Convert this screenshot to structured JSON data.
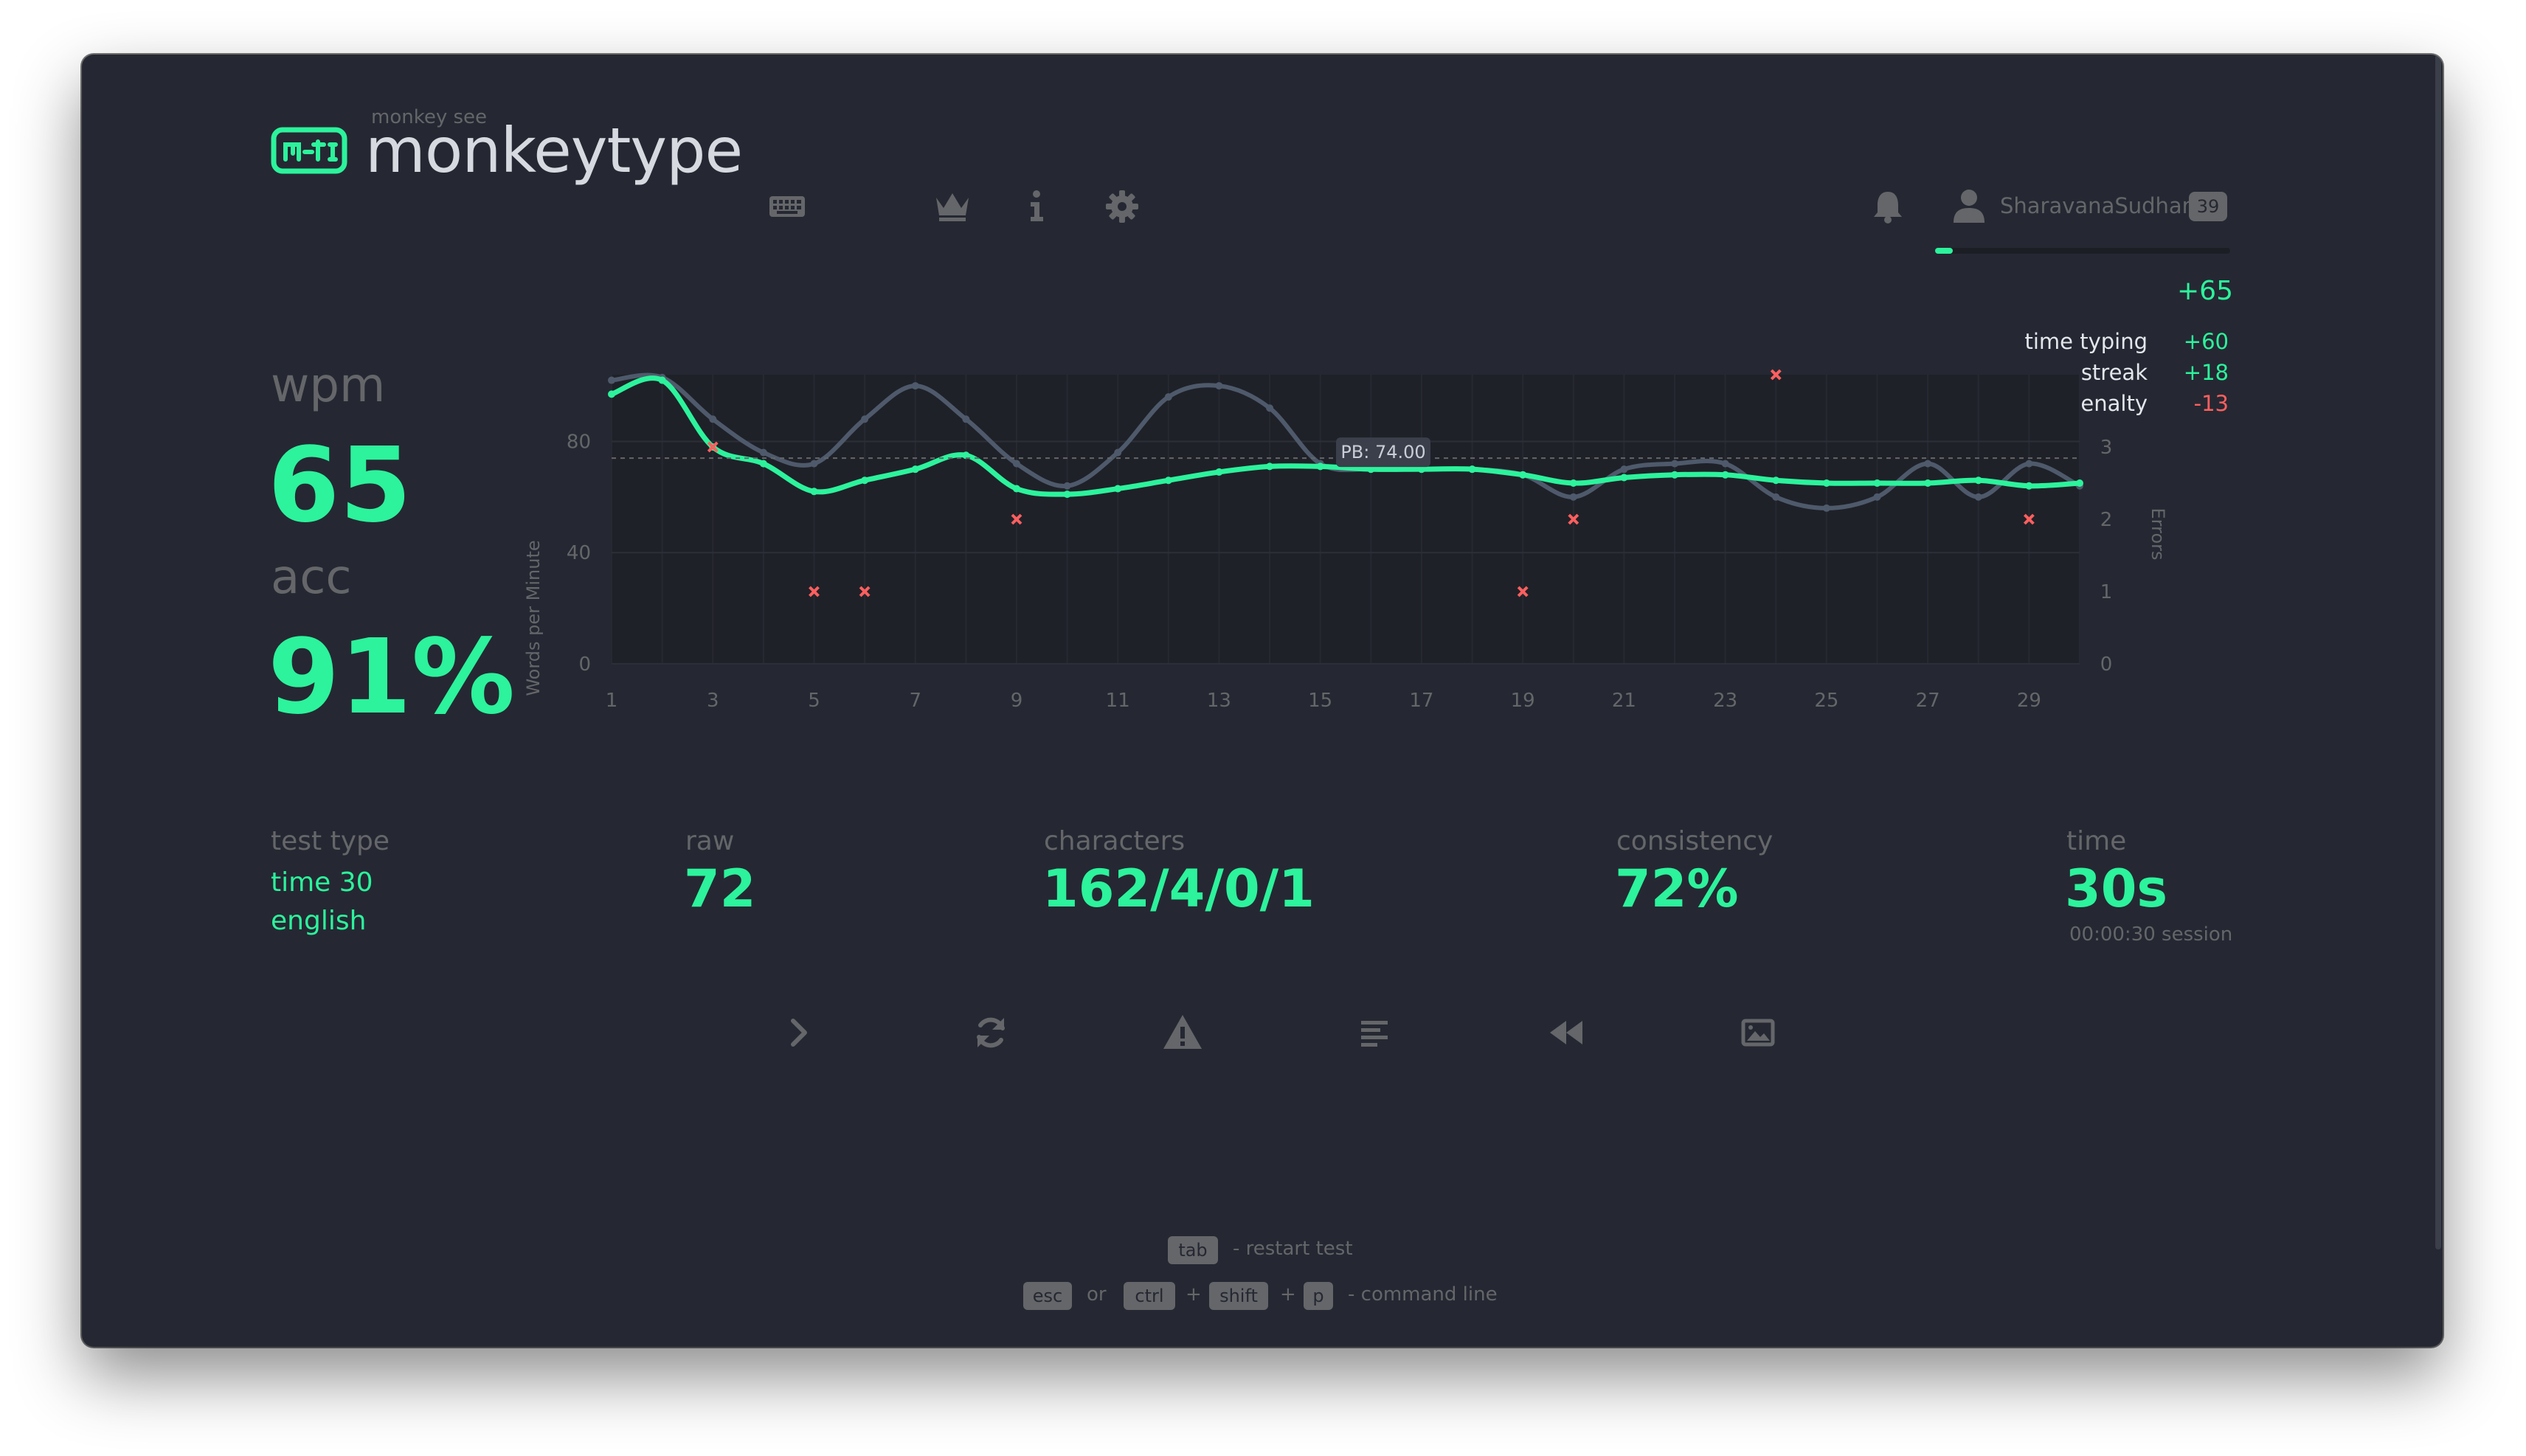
{
  "app": {
    "logo_subtitle": "monkey see",
    "logo_title": "monkeytype",
    "accent_color": "#2cf39c",
    "error_color": "#ff5f5f",
    "background_color": "#252832",
    "nav_icons": [
      "keyboard-icon",
      "crown-icon",
      "info-icon",
      "gear-icon"
    ]
  },
  "account": {
    "notifications_icon": "bell-icon",
    "user_icon": "user-icon",
    "username": "SharavanaSudhan",
    "level": "39",
    "xp_progress_fraction": 0.06,
    "xp_gained": "+65",
    "xp_breakdown": [
      {
        "label": "time typing",
        "value": "+60",
        "type": "positive"
      },
      {
        "label": "streak",
        "value": "+18",
        "type": "positive"
      },
      {
        "label": "accuracy penalty",
        "value": "-13",
        "type": "negative"
      }
    ]
  },
  "results": {
    "wpm_label": "wpm",
    "wpm": "65",
    "acc_label": "acc",
    "acc": "91%",
    "test_type_label": "test type",
    "test_type_mode": "time 30",
    "test_type_language": "english",
    "raw_label": "raw",
    "raw": "72",
    "characters_label": "characters",
    "characters": "162/4/0/1",
    "consistency_label": "consistency",
    "consistency": "72%",
    "time_label": "time",
    "time": "30s",
    "session_time": "00:00:30 session"
  },
  "chart_data": {
    "type": "line",
    "x": [
      1,
      2,
      3,
      4,
      5,
      6,
      7,
      8,
      9,
      10,
      11,
      12,
      13,
      14,
      15,
      16,
      17,
      18,
      19,
      20,
      21,
      22,
      23,
      24,
      25,
      26,
      27,
      28,
      29,
      30
    ],
    "x_ticks": [
      "1",
      "3",
      "5",
      "7",
      "9",
      "11",
      "13",
      "15",
      "17",
      "19",
      "21",
      "23",
      "25",
      "27",
      "29"
    ],
    "y_ticks": [
      "0",
      "40",
      "80"
    ],
    "y2_ticks": [
      "0",
      "1",
      "2",
      "3"
    ],
    "ylabel": "Words per Minute",
    "y2label": "Errors",
    "ylim": [
      0,
      104
    ],
    "y2lim": [
      0,
      4
    ],
    "pb_value": 74,
    "pb_label": "PB: 74.00",
    "series": [
      {
        "name": "wpm",
        "color": "#2cf39c",
        "values": [
          97,
          102,
          78,
          72,
          62,
          66,
          70,
          75,
          63,
          61,
          63,
          66,
          69,
          71,
          71,
          70,
          70,
          70,
          68,
          65,
          67,
          68,
          68,
          66,
          65,
          65,
          65,
          66,
          64,
          65
        ]
      },
      {
        "name": "raw",
        "color": "#4e5a6b",
        "values": [
          102,
          103,
          88,
          76,
          72,
          88,
          100,
          88,
          72,
          64,
          76,
          96,
          100,
          92,
          72,
          70,
          70,
          70,
          68,
          60,
          70,
          72,
          72,
          60,
          56,
          60,
          72,
          60,
          72,
          64
        ]
      },
      {
        "name": "errors",
        "color": "#ff5f5f",
        "points": [
          [
            3,
            3
          ],
          [
            5,
            1
          ],
          [
            6,
            1
          ],
          [
            9,
            2
          ],
          [
            19,
            1
          ],
          [
            20,
            2
          ],
          [
            24,
            4
          ],
          [
            29,
            2
          ]
        ]
      }
    ]
  },
  "actions": [
    {
      "name": "next-test-button",
      "icon": "chevron-right-icon"
    },
    {
      "name": "restart-button",
      "icon": "refresh-icon"
    },
    {
      "name": "toggle-burst-heatmap-button",
      "icon": "warning-icon"
    },
    {
      "name": "show-words-history-button",
      "icon": "text-lines-icon"
    },
    {
      "name": "watch-replay-button",
      "icon": "backward-icon"
    },
    {
      "name": "save-screenshot-button",
      "icon": "image-icon"
    }
  ],
  "footer": {
    "key_tab": "tab",
    "restart_hint": "- restart test",
    "key_esc": "esc",
    "or": "or",
    "key_ctrl": "ctrl",
    "plus": "+",
    "key_shift": "shift",
    "key_p": "p",
    "command_hint": "- command line"
  }
}
